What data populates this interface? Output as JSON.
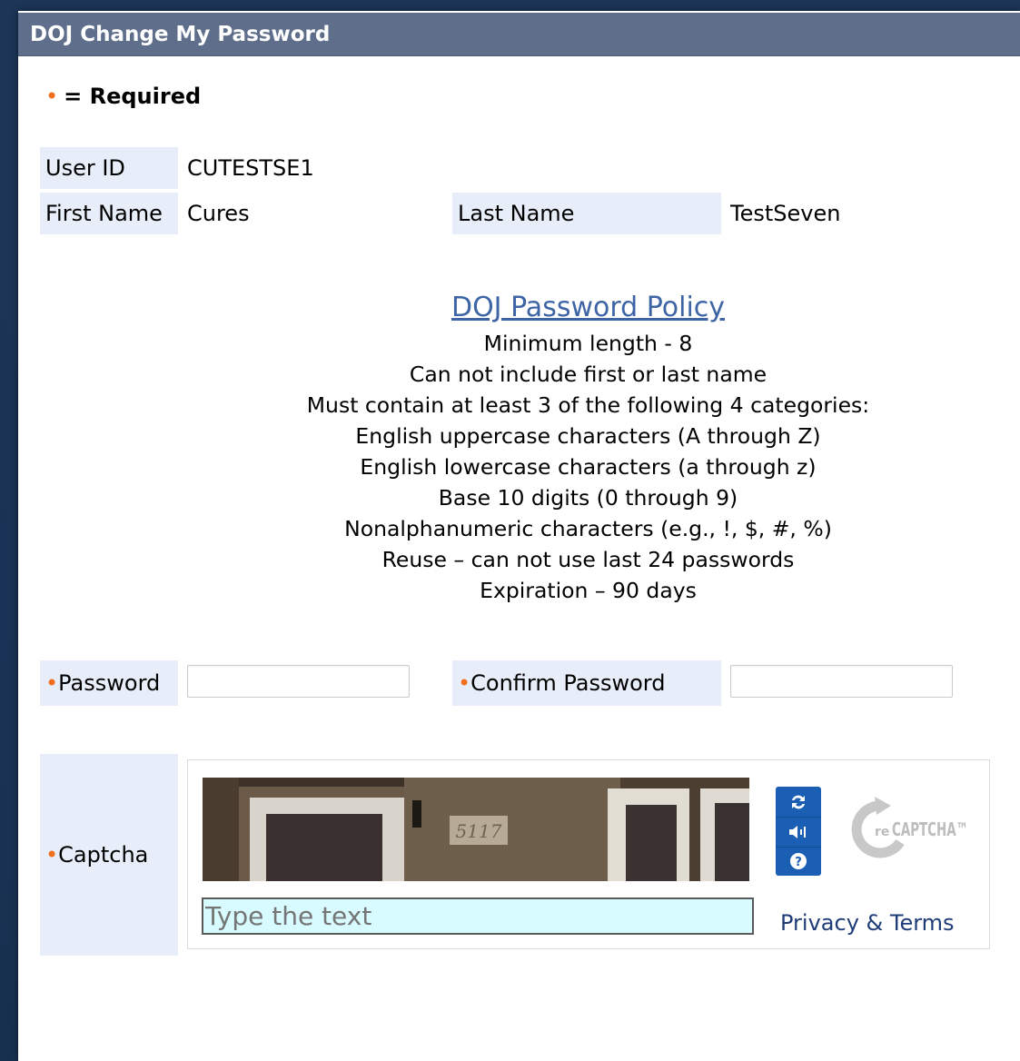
{
  "window": {
    "title": "DOJ Change My Password"
  },
  "required_note": {
    "marker": "•",
    "text": "= Required"
  },
  "user": {
    "user_id_label": "User ID",
    "user_id_value": "CUTESTSE1",
    "first_name_label": "First Name",
    "first_name_value": "Cures",
    "last_name_label": "Last Name",
    "last_name_value": "TestSeven"
  },
  "policy": {
    "title": "DOJ Password Policy",
    "lines": [
      "Minimum length - 8",
      "Can not include first or last name",
      "Must contain at least 3 of the following 4 categories:",
      "English uppercase characters (A through Z)",
      "English lowercase characters (a through z)",
      "Base 10 digits (0 through 9)",
      "Nonalphanumeric characters (e.g., !, $, #, %)",
      "Reuse – can not use last 24 passwords",
      "Expiration – 90 days"
    ]
  },
  "form": {
    "required_marker": "•",
    "password_label": "Password",
    "password_value": "",
    "confirm_label": "Confirm Password",
    "confirm_value": "",
    "captcha_label": "Captcha"
  },
  "captcha": {
    "image_text": "5117",
    "input_placeholder": "Type the text",
    "privacy_link": "Privacy & Terms",
    "logo_text": "reCAPTCHA™",
    "icons": [
      "refresh-icon",
      "audio-icon",
      "help-icon"
    ]
  },
  "colors": {
    "title_bar": "#5f6f8b",
    "label_bg": "#e8eef9",
    "required_dot": "#f07020",
    "link": "#3d64a5",
    "captcha_input_bg": "#d7fbff"
  }
}
